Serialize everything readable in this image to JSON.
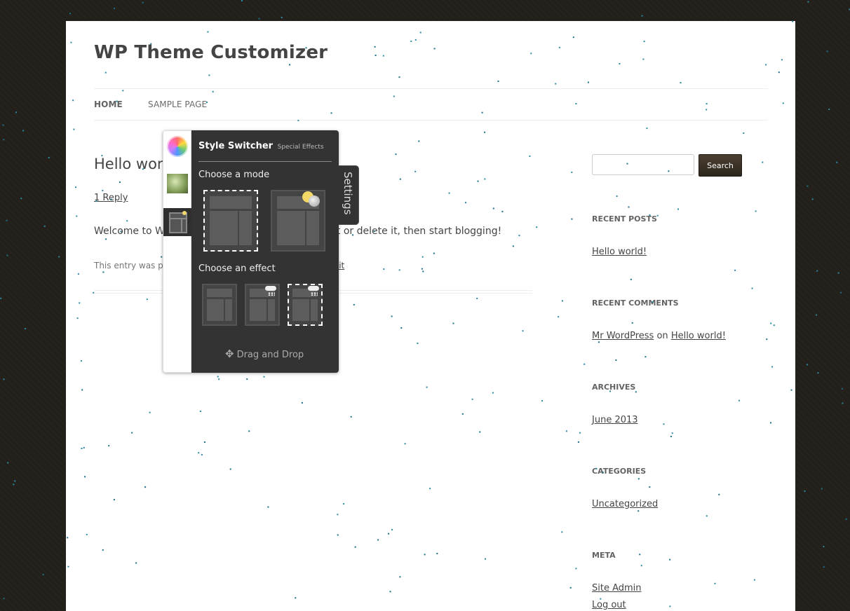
{
  "site": {
    "title": "WP Theme Customizer"
  },
  "nav": {
    "home": "HOME",
    "sample_page": "SAMPLE PAGE"
  },
  "post": {
    "title": "Hello world!",
    "reply": "1 Reply",
    "content": "Welcome to WordPress. This is your first post. Edit or delete it, then start blogging!",
    "meta_prefix": "This entry was posted in",
    "meta_edit": "Edit"
  },
  "sidebar": {
    "search_button": "Search",
    "recent_posts": {
      "title": "RECENT POSTS",
      "items": [
        "Hello world!"
      ]
    },
    "recent_comments": {
      "title": "RECENT COMMENTS",
      "author": "Mr WordPress",
      "on": "on",
      "post": "Hello world!"
    },
    "archives": {
      "title": "ARCHIVES",
      "items": [
        "June 2013"
      ]
    },
    "categories": {
      "title": "CATEGORIES",
      "items": [
        "Uncategorized"
      ]
    },
    "meta": {
      "title": "META",
      "items": [
        "Site Admin",
        "Log out"
      ]
    }
  },
  "switcher": {
    "title": "Style Switcher",
    "subtitle": "Special Effects",
    "choose_mode": "Choose a mode",
    "choose_effect": "Choose an effect",
    "drag_drop": "Drag and Drop",
    "settings": "Settings",
    "icons": [
      "color-wheel-icon",
      "background-image-icon",
      "layout-icon",
      "sun-moon-icon",
      "rain-cloud-icon",
      "move-icon"
    ]
  },
  "colors": {
    "panel": "#333333",
    "accent_button": "#3a3128",
    "background": "#221f1a"
  }
}
